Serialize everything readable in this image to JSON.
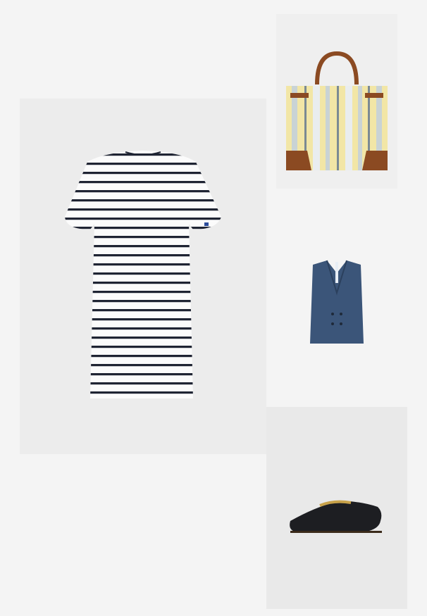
{
  "items": [
    {
      "name": "striped-tshirt-dress",
      "colors": [
        "#ffffff",
        "#1f2433"
      ]
    },
    {
      "name": "striped-tote-bag",
      "colors": [
        "#f2e6a6",
        "#c9d3d5",
        "#8b4a22"
      ]
    },
    {
      "name": "denim-waistcoat",
      "colors": [
        "#3b5579"
      ]
    },
    {
      "name": "black-loafer",
      "colors": [
        "#1d1e22",
        "#c8a24a"
      ]
    }
  ]
}
